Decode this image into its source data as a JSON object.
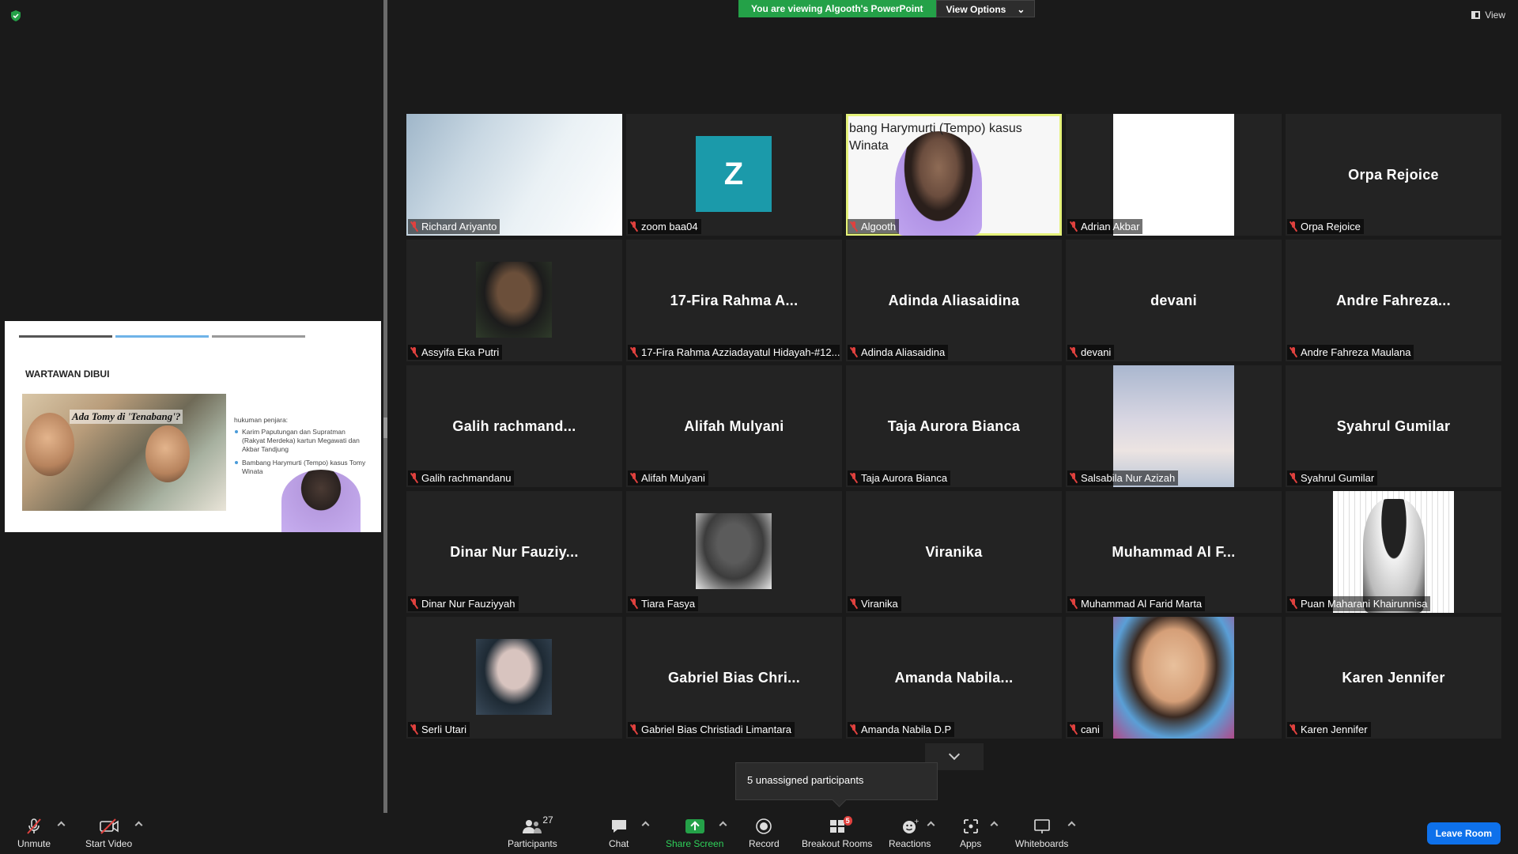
{
  "banner": {
    "text": "You are viewing Algooth's PowerPoint",
    "view_options": "View Options",
    "view_button": "View"
  },
  "slide": {
    "title": "WARTAWAN DIBUI",
    "headline": "Ada Tomy di 'Tenabang'?",
    "bullet_head": "hukuman penjara:",
    "bullets": [
      "Karim Paputungan dan Supratman (Rakyat Merdeka) kartun Megawati dan Akbar Tandjung",
      "Bambang Harymurti (Tempo) kasus Tomy Winata"
    ]
  },
  "tiles": [
    {
      "label": "Richard Ariyanto",
      "type": "screen"
    },
    {
      "label": "zoom baa04",
      "type": "initial",
      "initial": "Z"
    },
    {
      "label": "Algooth",
      "type": "video",
      "caption": "bang Harymurti (Tempo) kasus\nWinata",
      "active": true
    },
    {
      "label": "Adrian Akbar",
      "type": "white"
    },
    {
      "label": "Orpa Rejoice",
      "type": "name",
      "display": "Orpa Rejoice"
    },
    {
      "label": "Assyifa Eka Putri",
      "type": "photo",
      "colors": [
        "#2f3b2a",
        "#6b4f3a",
        "#1c1c1c"
      ]
    },
    {
      "label": "17-Fira Rahma Azziadayatul Hidayah-#12...",
      "type": "name",
      "display": "17-Fira Rahma A..."
    },
    {
      "label": "Adinda Aliasaidina",
      "type": "name",
      "display": "Adinda Aliasaidina"
    },
    {
      "label": "devani",
      "type": "name",
      "display": "devani"
    },
    {
      "label": "Andre Fahreza Maulana",
      "type": "name",
      "display": "Andre Fahreza..."
    },
    {
      "label": "Galih rachmandanu",
      "type": "name",
      "display": "Galih rachmand..."
    },
    {
      "label": "Alifah Mulyani",
      "type": "name",
      "display": "Alifah Mulyani"
    },
    {
      "label": "Taja Aurora Bianca",
      "type": "name",
      "display": "Taja Aurora Bianca"
    },
    {
      "label": "Salsabila Nur Azizah",
      "type": "sky"
    },
    {
      "label": "Syahrul Gumilar",
      "type": "name",
      "display": "Syahrul Gumilar"
    },
    {
      "label": "Dinar Nur Fauziyyah",
      "type": "name",
      "display": "Dinar Nur Fauziy..."
    },
    {
      "label": "Tiara Fasya",
      "type": "photo",
      "colors": [
        "#e8e8e8",
        "#5b5b5b",
        "#3c3c3c"
      ]
    },
    {
      "label": "Viranika",
      "type": "name",
      "display": "Viranika"
    },
    {
      "label": "Muhammad Al Farid Marta",
      "type": "name",
      "display": "Muhammad Al F..."
    },
    {
      "label": "Puan Maharani Khairunnisa",
      "type": "manga"
    },
    {
      "label": "Serli Utari",
      "type": "photo",
      "colors": [
        "#3a4a5a",
        "#d8c4bf",
        "#1e2a34"
      ]
    },
    {
      "label": "Gabriel Bias Christiadi Limantara",
      "type": "name",
      "display": "Gabriel Bias Chri..."
    },
    {
      "label": "Amanda Nabila D.P",
      "type": "name",
      "display": "Amanda Nabila..."
    },
    {
      "label": "cani",
      "type": "kid"
    },
    {
      "label": "Karen Jennifer",
      "type": "name",
      "display": "Karen Jennifer"
    }
  ],
  "tooltip": "5 unassigned participants",
  "toolbar": {
    "unmute": "Unmute",
    "start_video": "Start Video",
    "participants": "Participants",
    "participants_count": "27",
    "chat": "Chat",
    "share_screen": "Share Screen",
    "record": "Record",
    "breakout_rooms": "Breakout Rooms",
    "breakout_badge": "5",
    "reactions": "Reactions",
    "apps": "Apps",
    "whiteboards": "Whiteboards",
    "leave_room": "Leave Room"
  },
  "colors": {
    "share_green": "#24a148",
    "leave_blue": "#0e71eb",
    "mic_red": "#e0413e",
    "active_border": "#e5f27a"
  }
}
